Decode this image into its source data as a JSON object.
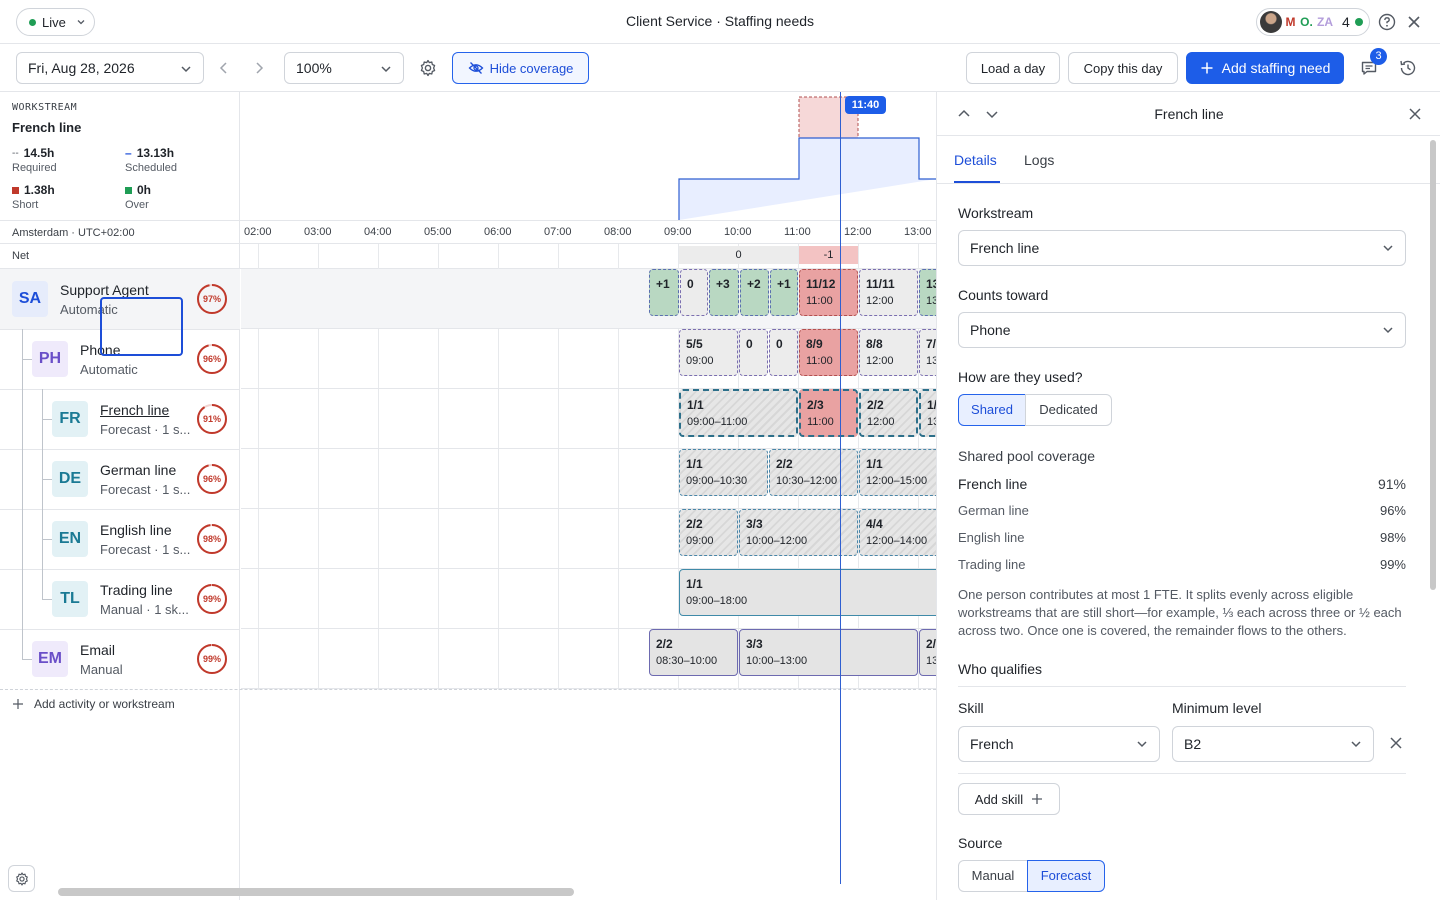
{
  "topbar": {
    "live_label": "Live",
    "title": "Client Service · Staffing needs",
    "presence": {
      "letters": [
        "M",
        "O.",
        "ZA"
      ],
      "letter_colors": [
        "#c0392b",
        "#1f9d55",
        "#b39ddb"
      ],
      "count": "4"
    }
  },
  "toolbar": {
    "date": "Fri, Aug 28, 2026",
    "zoom": "100%",
    "hide_coverage": "Hide coverage",
    "load_day": "Load a day",
    "copy_day": "Copy this day",
    "add_need": "Add staffing need",
    "notif_count": "3"
  },
  "left": {
    "ws_caption": "WORKSTREAM",
    "ws_name": "French line",
    "stats": [
      {
        "value": "14.5h",
        "label": "Required",
        "marker": "--"
      },
      {
        "value": "13.13h",
        "label": "Scheduled",
        "marker": "–"
      },
      {
        "value": "1.38h",
        "label": "Short",
        "color": "#c0392b"
      },
      {
        "value": "0h",
        "label": "Over",
        "color": "#1f9d55"
      }
    ],
    "timezone": "Amsterdam · UTC+02:00",
    "net_label": "Net",
    "rows": [
      {
        "abbr": "SA",
        "name": "Support Agent",
        "sub": "Automatic",
        "pct": "97%",
        "pct_value": 0.97
      },
      {
        "abbr": "PH",
        "name": "Phone",
        "sub": "Automatic",
        "pct": "96%",
        "pct_value": 0.96
      },
      {
        "abbr": "FR",
        "name": "French line",
        "sub": "Forecast · 1 s...",
        "pct": "91%",
        "pct_value": 0.91
      },
      {
        "abbr": "DE",
        "name": "German line",
        "sub": "Forecast · 1 s...",
        "pct": "96%",
        "pct_value": 0.96
      },
      {
        "abbr": "EN",
        "name": "English line",
        "sub": "Forecast · 1 s...",
        "pct": "98%",
        "pct_value": 0.98
      },
      {
        "abbr": "TL",
        "name": "Trading line",
        "sub": "Manual · 1 sk...",
        "pct": "99%",
        "pct_value": 0.99
      },
      {
        "abbr": "EM",
        "name": "Email",
        "sub": "Manual",
        "pct": "99%",
        "pct_value": 0.99
      }
    ],
    "add_row": "Add activity or workstream"
  },
  "timeline": {
    "hours": [
      "02:00",
      "03:00",
      "04:00",
      "05:00",
      "06:00",
      "07:00",
      "08:00",
      "09:00",
      "10:00",
      "11:00",
      "12:00",
      "13:00"
    ],
    "now": "11:40",
    "net": [
      "0",
      "-1"
    ],
    "cells": {
      "sa": [
        {
          "top": "+1",
          "bottom": ""
        },
        {
          "top": "0",
          "bottom": ""
        },
        {
          "top": "+3",
          "bottom": ""
        },
        {
          "top": "+2",
          "bottom": ""
        },
        {
          "top": "+1",
          "bottom": ""
        },
        {
          "top": "11/12",
          "bottom": "11:00"
        },
        {
          "top": "11/11",
          "bottom": "12:00"
        },
        {
          "top": "13",
          "bottom": "13"
        }
      ],
      "ph": [
        {
          "top": "5/5",
          "bottom": "09:00"
        },
        {
          "top": "0",
          "bottom": ""
        },
        {
          "top": "0",
          "bottom": ""
        },
        {
          "top": "8/9",
          "bottom": "11:00"
        },
        {
          "top": "8/8",
          "bottom": "12:00"
        },
        {
          "top": "7/",
          "bottom": "13"
        }
      ],
      "fr": [
        {
          "top": "1/1",
          "bottom": "09:00–11:00"
        },
        {
          "top": "2/3",
          "bottom": "11:00"
        },
        {
          "top": "2/2",
          "bottom": "12:00"
        },
        {
          "top": "1/",
          "bottom": "13"
        }
      ],
      "de": [
        {
          "top": "1/1",
          "bottom": "09:00–10:30"
        },
        {
          "top": "2/2",
          "bottom": "10:30–12:00"
        },
        {
          "top": "1/1",
          "bottom": "12:00–15:00"
        }
      ],
      "en": [
        {
          "top": "2/2",
          "bottom": "09:00"
        },
        {
          "top": "3/3",
          "bottom": "10:00–12:00"
        },
        {
          "top": "4/4",
          "bottom": "12:00–14:00"
        }
      ],
      "tl": [
        {
          "top": "1/1",
          "bottom": "09:00–18:00"
        }
      ],
      "em": [
        {
          "top": "2/2",
          "bottom": "08:30–10:00"
        },
        {
          "top": "3/3",
          "bottom": "10:00–13:00"
        },
        {
          "top": "2/",
          "bottom": "13"
        }
      ]
    }
  },
  "panel": {
    "title": "French line",
    "tabs": [
      "Details",
      "Logs"
    ],
    "workstream_label": "Workstream",
    "workstream_value": "French line",
    "counts_label": "Counts toward",
    "counts_value": "Phone",
    "usage_label": "How are they used?",
    "usage_options": [
      "Shared",
      "Dedicated"
    ],
    "usage_selected": "Shared",
    "pool_label": "Shared pool coverage",
    "pool": [
      {
        "name": "French line",
        "pct": "91%"
      },
      {
        "name": "German line",
        "pct": "96%"
      },
      {
        "name": "English line",
        "pct": "98%"
      },
      {
        "name": "Trading line",
        "pct": "99%"
      }
    ],
    "note": "One person contributes at most 1 FTE. It splits evenly across eligible workstreams that are still short—for example, ⅓ each across three or ½ each across two. Once one is covered, the remainder flows to the others.",
    "qualifies_label": "Who qualifies",
    "skill_label": "Skill",
    "skill_value": "French",
    "level_label": "Minimum level",
    "level_value": "B2",
    "add_skill": "Add skill",
    "source_label": "Source",
    "source_options": [
      "Manual",
      "Forecast"
    ],
    "source_selected": "Forecast"
  },
  "colors": {
    "accent": "#1d5de8",
    "short": "#c0392b",
    "over": "#1f9d55",
    "coverage_fill": "#e8eeff"
  }
}
